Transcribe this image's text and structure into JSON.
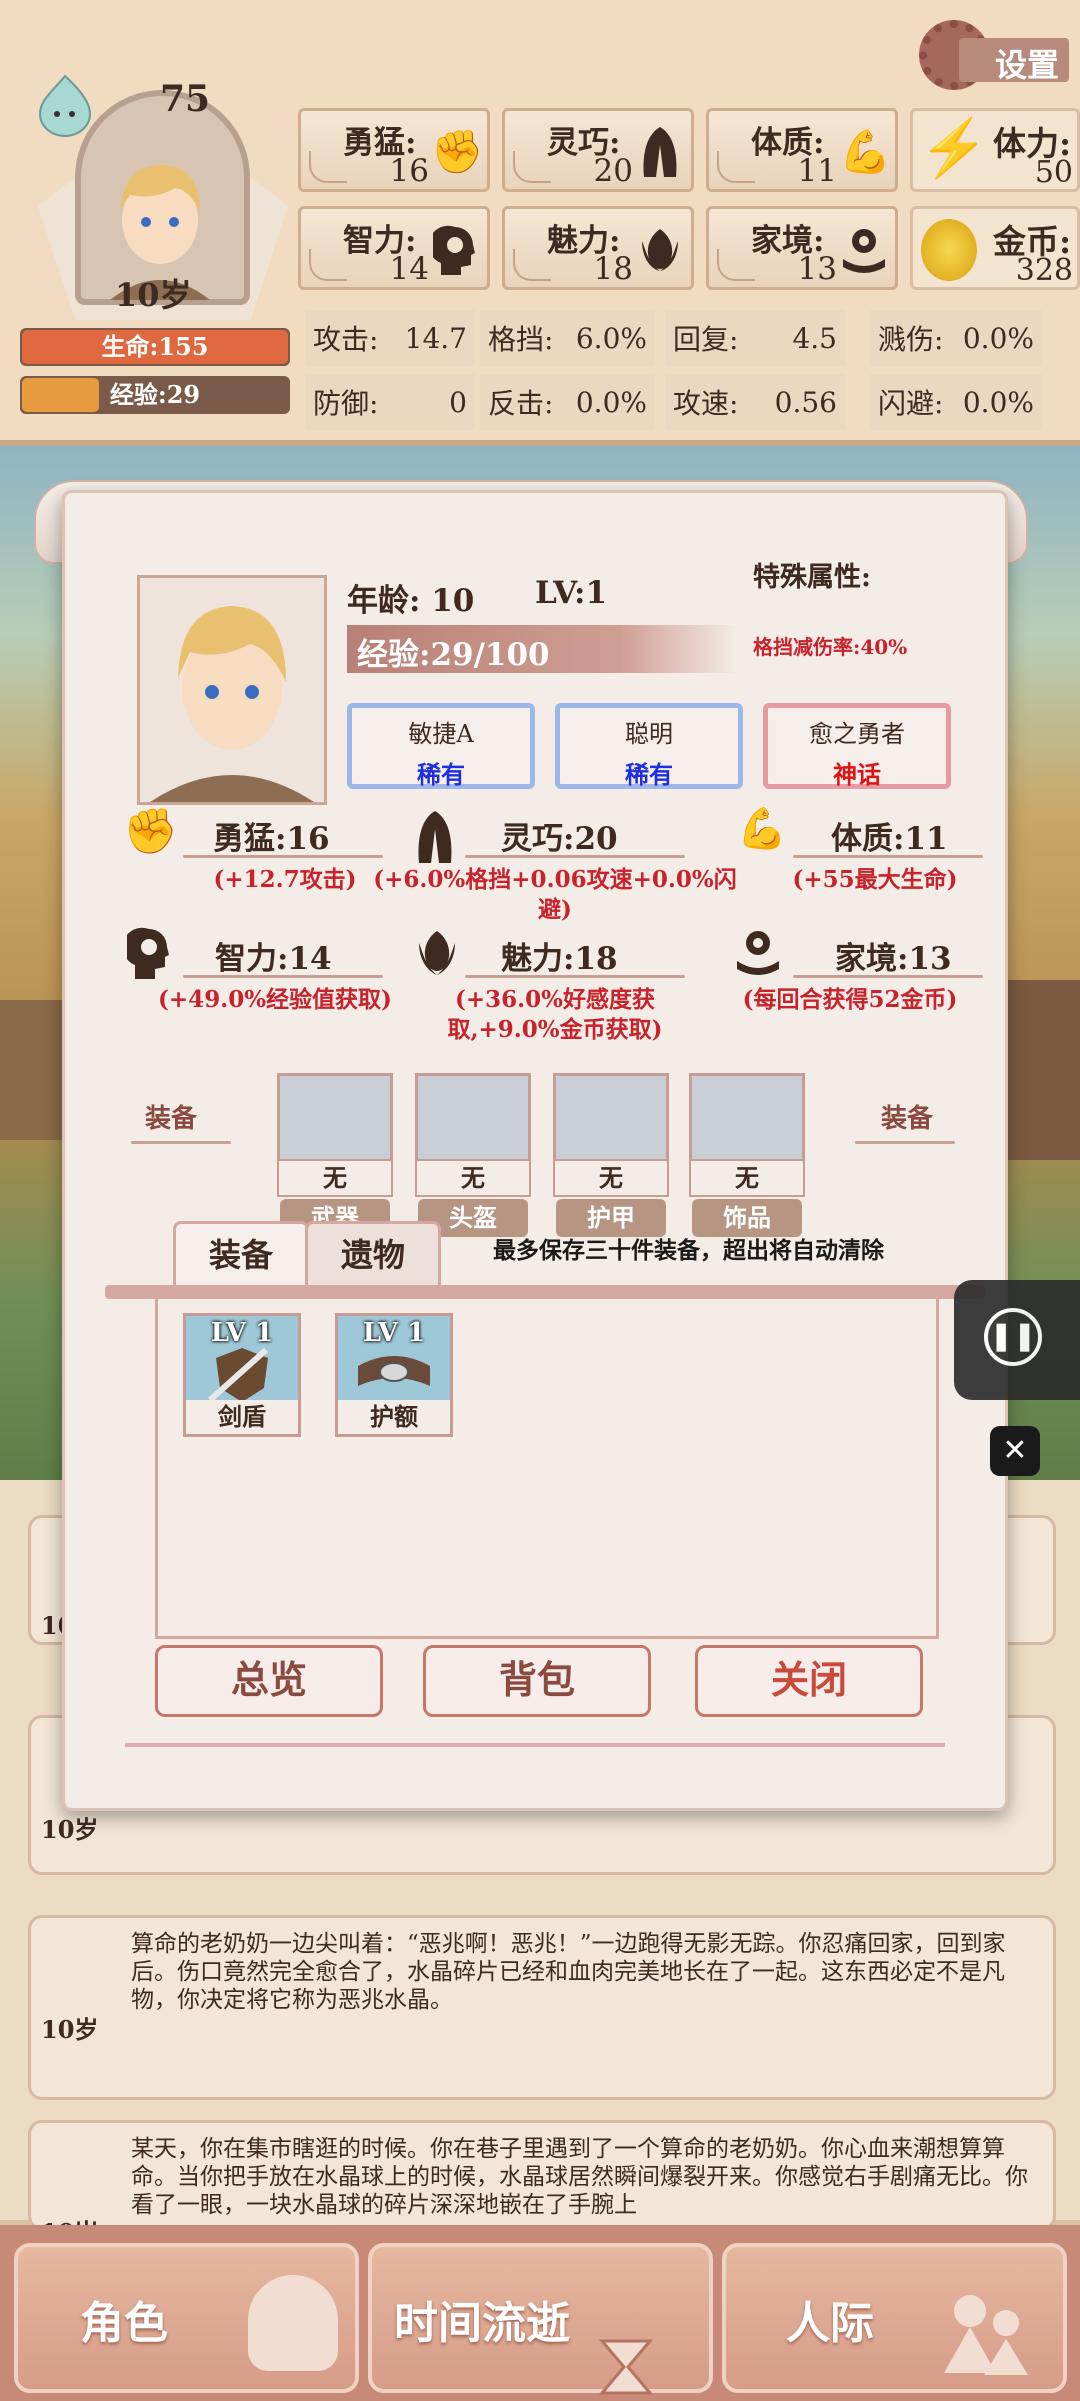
{
  "player": {
    "spirit_value": "75",
    "age_label": "10岁",
    "hp_label": "生命:155",
    "exp_label": "经验:29",
    "hp_fraction": 1.0,
    "exp_fraction": 0.29
  },
  "settings_label": "设置",
  "stats": [
    {
      "label": "勇猛:",
      "value": "16",
      "icon": "fist-icon"
    },
    {
      "label": "灵巧:",
      "value": "20",
      "icon": "cloak-icon"
    },
    {
      "label": "体质:",
      "value": "11",
      "icon": "muscle-arm-icon"
    },
    {
      "label": "智力:",
      "value": "14",
      "icon": "brain-head-icon"
    },
    {
      "label": "魅力:",
      "value": "18",
      "icon": "tulip-icon"
    },
    {
      "label": "家境:",
      "value": "13",
      "icon": "coin-hand-icon"
    }
  ],
  "currency": [
    {
      "label": "体力:",
      "value": "50",
      "icon": "lightning-icon"
    },
    {
      "label": "金币:",
      "value": "328",
      "icon": "gold-coin-icon"
    }
  ],
  "combat": [
    {
      "label": "攻击:",
      "value": "14.7"
    },
    {
      "label": "格挡:",
      "value": "6.0%"
    },
    {
      "label": "回复:",
      "value": "4.5"
    },
    {
      "label": "溅伤:",
      "value": "0.0%"
    },
    {
      "label": "防御:",
      "value": "0"
    },
    {
      "label": "反击:",
      "value": "0.0%"
    },
    {
      "label": "攻速:",
      "value": "0.56"
    },
    {
      "label": "闪避:",
      "value": "0.0%"
    }
  ],
  "dialog": {
    "age_text": "年龄: 10",
    "level_text": "LV:1",
    "exp_text": "经验:29/100",
    "special_title": "特殊属性:",
    "special_value": "格挡减伤率:40%",
    "tags": [
      {
        "name": "敏捷A",
        "rarity": "稀有",
        "rarity_color": "#1d2fe0",
        "border": "#9db7e8"
      },
      {
        "name": "聪明",
        "rarity": "稀有",
        "rarity_color": "#1d2fe0",
        "border": "#9db7e8"
      },
      {
        "name": "愈之勇者",
        "rarity": "神话",
        "rarity_color": "#e01212",
        "border": "#e59aa4"
      }
    ],
    "attributes": [
      {
        "title": "勇猛:16",
        "effect": "(+12.7攻击)"
      },
      {
        "title": "灵巧:20",
        "effect": "(+6.0%格挡+0.06攻速+0.0%闪避)"
      },
      {
        "title": "体质:11",
        "effect": "(+55最大生命)"
      },
      {
        "title": "智力:14",
        "effect": "(+49.0%经验值获取)"
      },
      {
        "title": "魅力:18",
        "effect": "(+36.0%好感度获取,+9.0%金币获取)"
      },
      {
        "title": "家境:13",
        "effect": "(每回合获得52金币)"
      }
    ],
    "equip_label_left": "装备",
    "equip_label_right": "装备",
    "slots": [
      {
        "value": "无",
        "name": "武器"
      },
      {
        "value": "无",
        "name": "头盔"
      },
      {
        "value": "无",
        "name": "护甲"
      },
      {
        "value": "无",
        "name": "饰品"
      }
    ],
    "tabs": [
      "装备",
      "遗物"
    ],
    "notice": "最多保存三十件装备，超出将自动清除",
    "items": [
      {
        "level": "LV 1",
        "name": "剑盾"
      },
      {
        "level": "LV 1",
        "name": "护额"
      }
    ],
    "buttons": {
      "overview": "总览",
      "bag": "背包",
      "close": "关闭"
    }
  },
  "logs": [
    {
      "age": "10岁",
      "text": ""
    },
    {
      "age": "10岁",
      "text": ""
    },
    {
      "age": "10岁",
      "text": "算命的老奶奶一边尖叫着：“恶兆啊！恶兆！”一边跑得无影无踪。你忍痛回家，回到家后。伤口竟然完全愈合了，水晶碎片已经和血肉完美地长在了一起。这东西必定不是凡物，你决定将它称为恶兆水晶。"
    },
    {
      "age": "10岁",
      "text": "某天，你在集市瞎逛的时候。你在巷子里遇到了一个算命的老奶奶。你心血来潮想算算命。当你把手放在水晶球上的时候，水晶球居然瞬间爆裂开来。你感觉右手剧痛无比。你看了一眼，一块水晶球的碎片深深地嵌在了手腕上"
    }
  ],
  "nav": [
    "角色",
    "时间流逝",
    "人际"
  ]
}
